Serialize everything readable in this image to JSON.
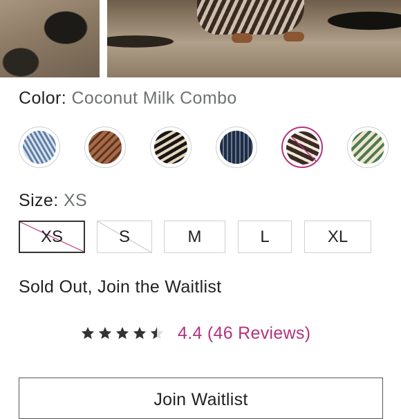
{
  "color": {
    "label": "Color:",
    "value": "Coconut Milk Combo",
    "selected_index": 4
  },
  "swatches": [
    {
      "name": "blue-chevron-swatch",
      "available": true
    },
    {
      "name": "rust-chevron-swatch",
      "available": true
    },
    {
      "name": "black-cream-swatch",
      "available": true
    },
    {
      "name": "navy-tie-dye-swatch",
      "available": true
    },
    {
      "name": "coconut-milk-combo-swatch",
      "available": false
    },
    {
      "name": "green-stripe-swatch",
      "available": true
    }
  ],
  "size": {
    "label": "Size:",
    "value": "XS",
    "options": [
      {
        "label": "XS",
        "available": false,
        "selected": true
      },
      {
        "label": "S",
        "available": false,
        "selected": false
      },
      {
        "label": "M",
        "available": true,
        "selected": false
      },
      {
        "label": "L",
        "available": true,
        "selected": false
      },
      {
        "label": "XL",
        "available": true,
        "selected": false
      }
    ]
  },
  "status": {
    "text": "Sold Out, Join the Waitlist"
  },
  "rating": {
    "value": 4.4,
    "stars": 5,
    "text": "4.4 (46 Reviews)"
  },
  "cta": {
    "label": "Join Waitlist"
  },
  "colors": {
    "accent": "#b5327d",
    "text": "#222222",
    "muted": "#6e7274",
    "border": "#cfcfcf"
  }
}
